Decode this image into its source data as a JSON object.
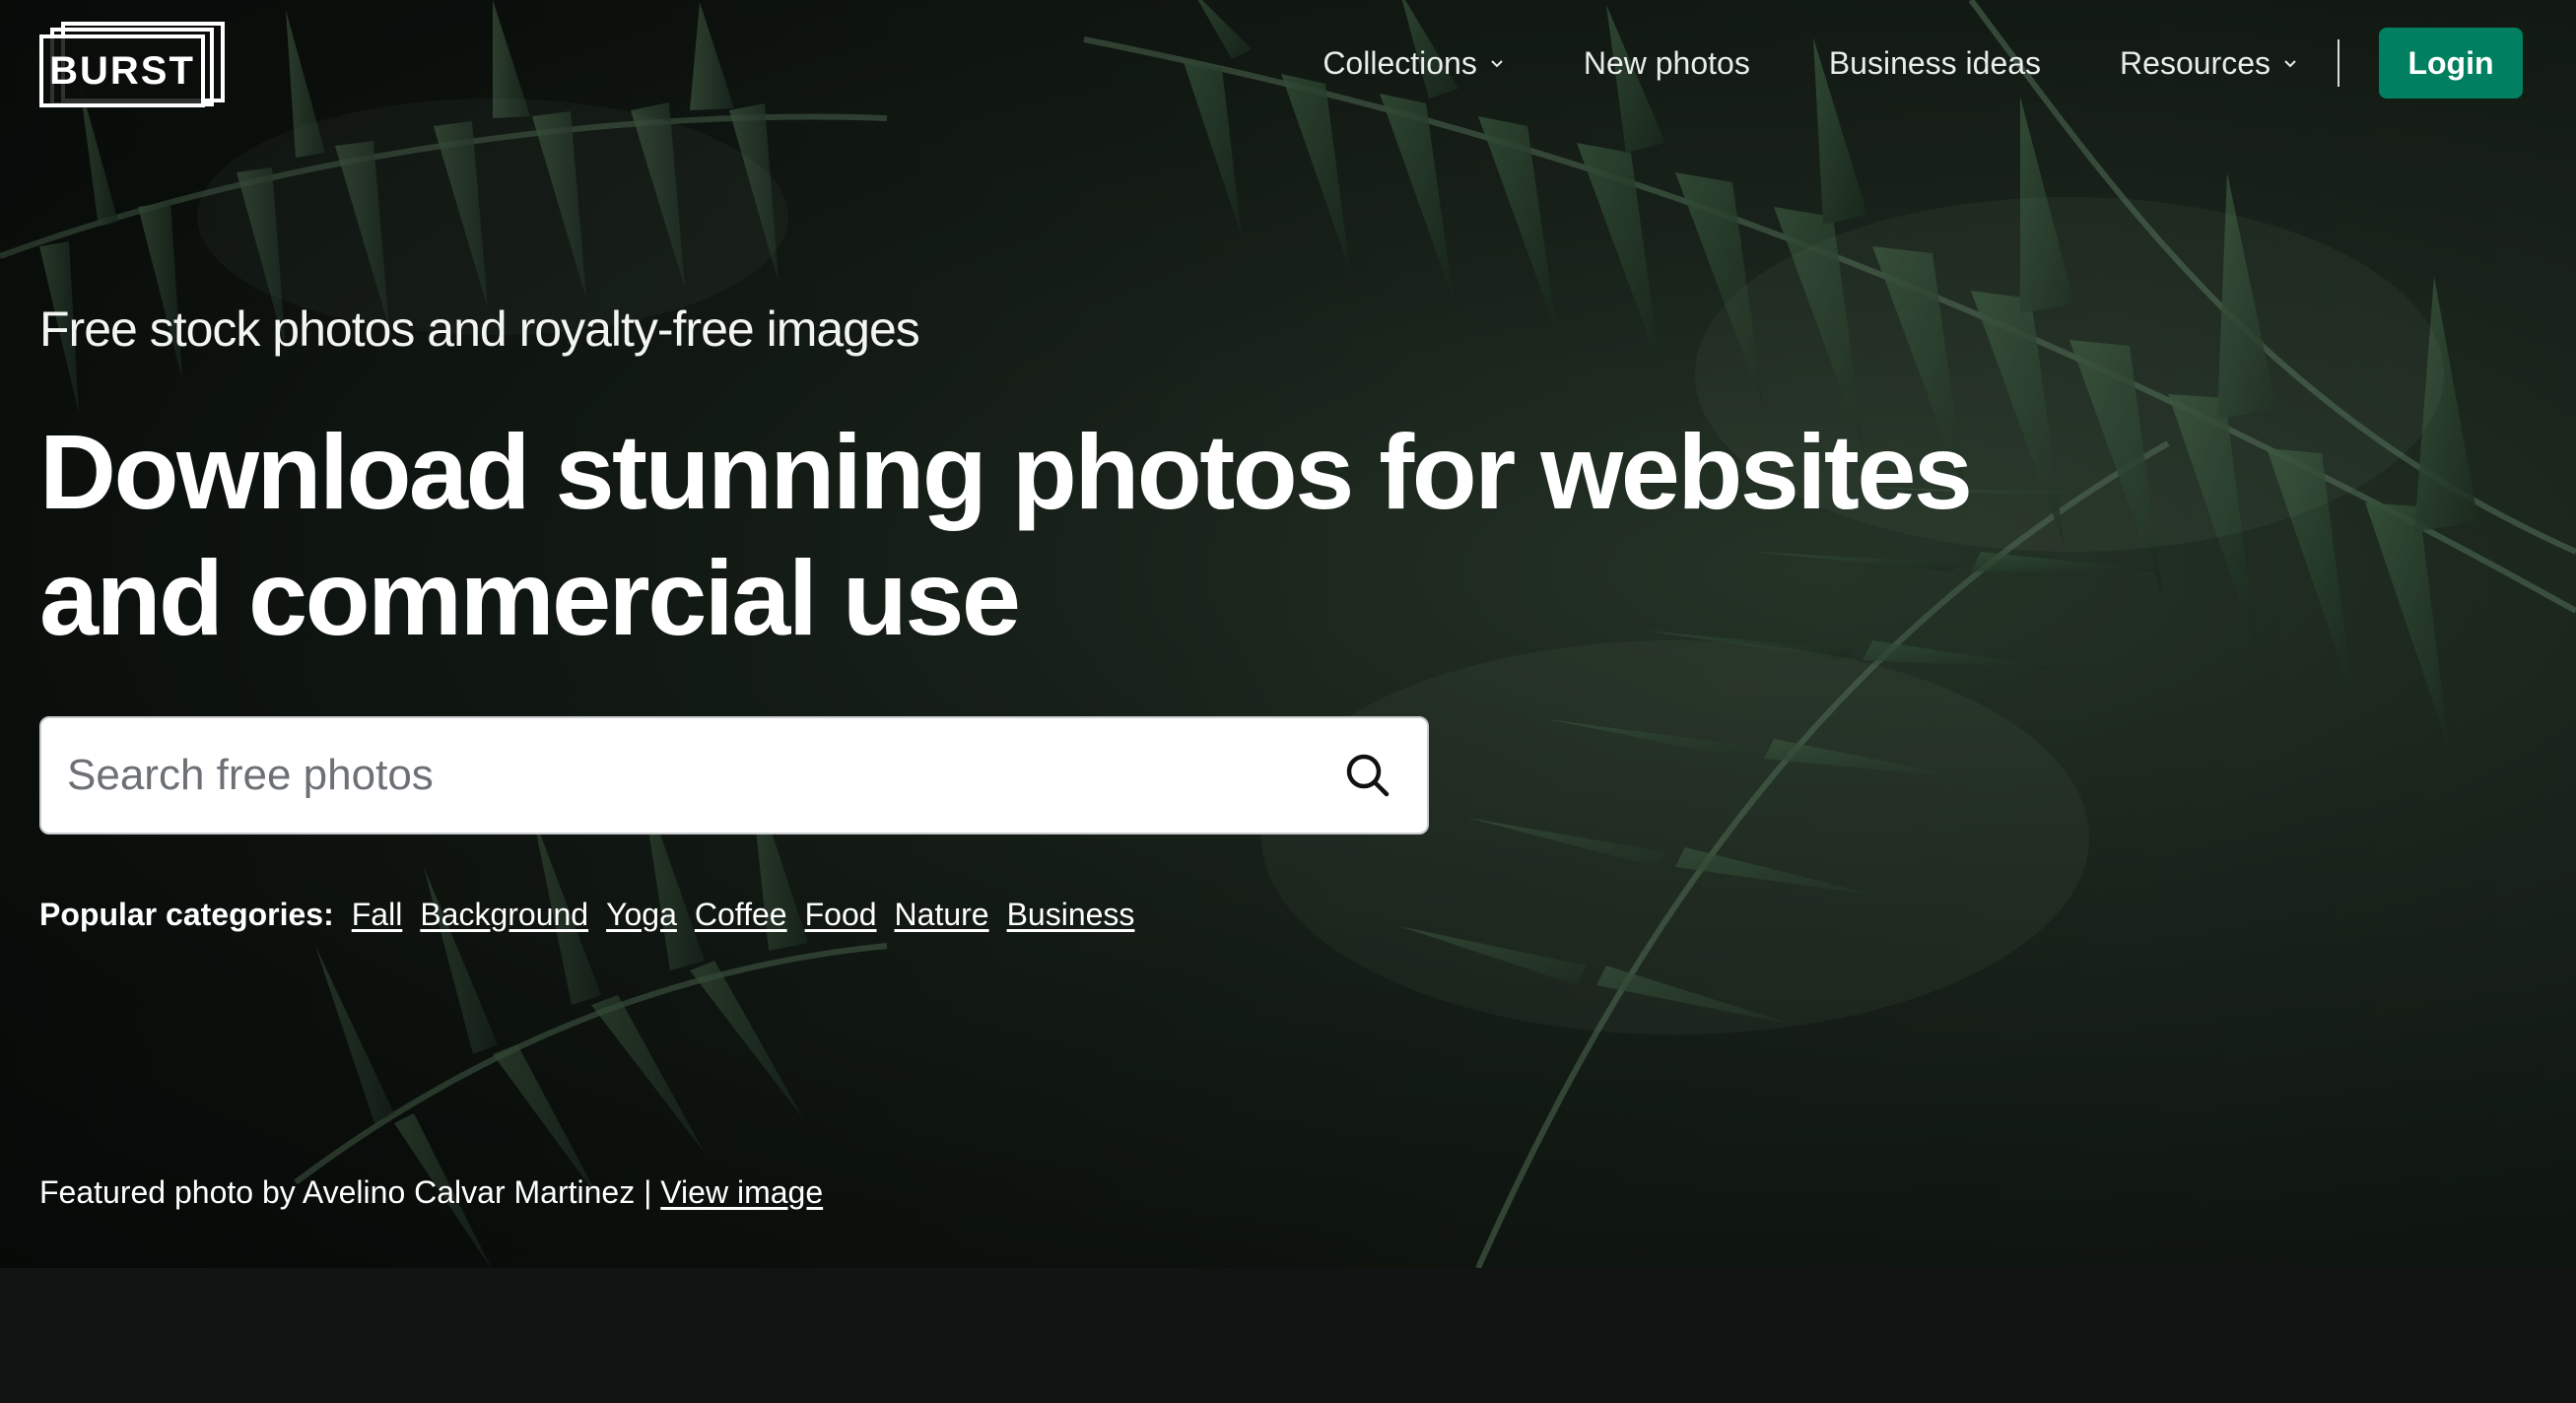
{
  "brand": {
    "logo_text": "BURST"
  },
  "nav": {
    "items": [
      {
        "label": "Collections",
        "has_dropdown": true
      },
      {
        "label": "New photos",
        "has_dropdown": false
      },
      {
        "label": "Business ideas",
        "has_dropdown": false
      },
      {
        "label": "Resources",
        "has_dropdown": true
      }
    ],
    "login_label": "Login"
  },
  "hero": {
    "subtitle": "Free stock photos and royalty-free images",
    "headline": "Download stunning photos for websites and commercial use",
    "search": {
      "placeholder": "Search free photos",
      "value": ""
    },
    "categories": {
      "label": "Popular categories:",
      "items": [
        "Fall",
        "Background",
        "Yoga",
        "Coffee",
        "Food",
        "Nature",
        "Business"
      ]
    },
    "credit": {
      "text": "Featured photo by Avelino Calvar Martinez | ",
      "link_label": "View image"
    }
  },
  "colors": {
    "accent": "#008060",
    "background_dark": "#121413",
    "foliage": "#2f4a34"
  },
  "icons": {
    "search": "search-icon",
    "dropdown": "chevron-down-icon"
  }
}
